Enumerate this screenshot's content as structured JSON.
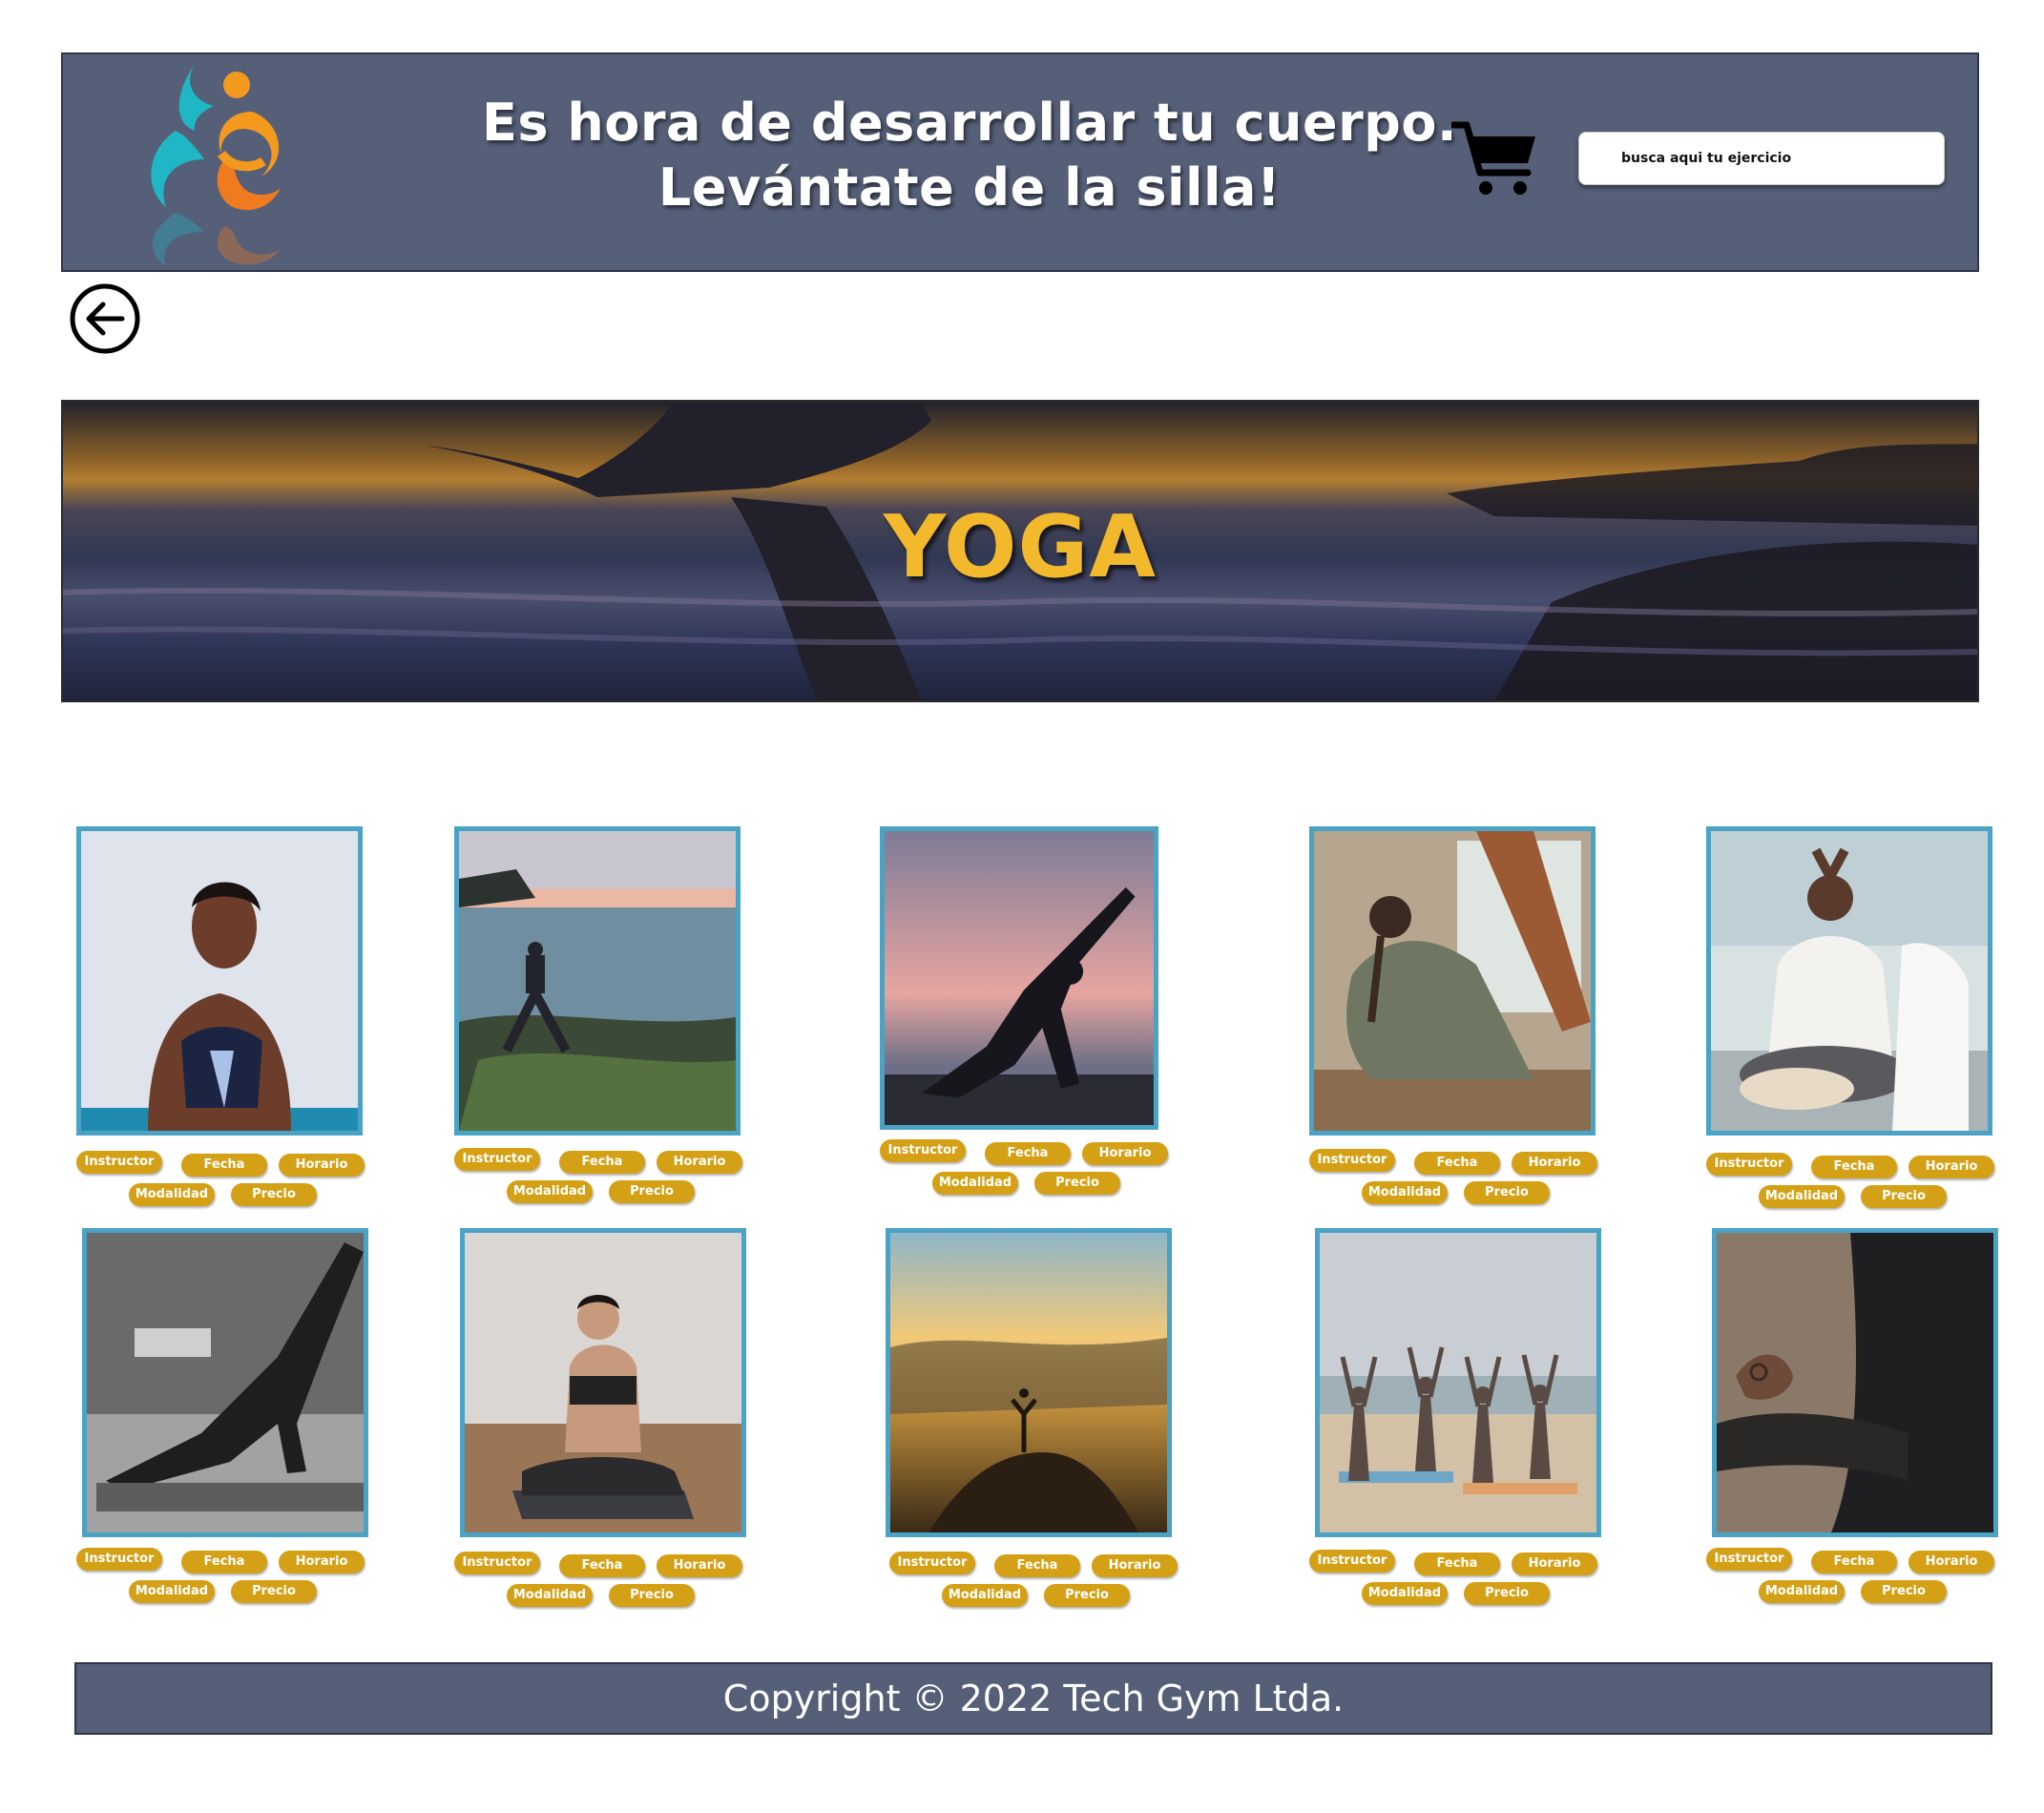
{
  "header": {
    "tagline_line1": "Es hora de desarrollar tu cuerpo.",
    "tagline_line2": "Levántate de la silla!",
    "logo_icon": "figure-logo-icon",
    "cart_icon": "shopping-cart-icon",
    "search_placeholder": "busca aqui tu ejercicio"
  },
  "nav": {
    "back_icon": "arrow-left-circle-icon"
  },
  "hero": {
    "title": "YOGA"
  },
  "cards": [
    {
      "image": "woman-praying-hands-yoga",
      "tags": {
        "instructor": "Instructor",
        "fecha": "Fecha",
        "horario": "Horario",
        "modalidad": "Modalidad",
        "precio": "Precio"
      }
    },
    {
      "image": "woman-yoga-on-rocks-by-sea",
      "tags": {
        "instructor": "Instructor",
        "fecha": "Fecha",
        "horario": "Horario",
        "modalidad": "Modalidad",
        "precio": "Precio"
      }
    },
    {
      "image": "silhouette-lunge-sunset",
      "tags": {
        "instructor": "Instructor",
        "fecha": "Fecha",
        "horario": "Horario",
        "modalidad": "Modalidad",
        "precio": "Precio"
      }
    },
    {
      "image": "woman-pigeon-pose-indoors",
      "tags": {
        "instructor": "Instructor",
        "fecha": "Fecha",
        "horario": "Horario",
        "modalidad": "Modalidad",
        "precio": "Precio"
      }
    },
    {
      "image": "woman-meditating-class",
      "tags": {
        "instructor": "Instructor",
        "fecha": "Fecha",
        "horario": "Horario",
        "modalidad": "Modalidad",
        "precio": "Precio"
      }
    },
    {
      "image": "downward-dog-black-and-white",
      "tags": {
        "instructor": "Instructor",
        "fecha": "Fecha",
        "horario": "Horario",
        "modalidad": "Modalidad",
        "precio": "Precio"
      }
    },
    {
      "image": "woman-seated-on-mat",
      "tags": {
        "instructor": "Instructor",
        "fecha": "Fecha",
        "horario": "Horario",
        "modalidad": "Modalidad",
        "precio": "Precio"
      }
    },
    {
      "image": "tree-pose-mountain-sunrise",
      "tags": {
        "instructor": "Instructor",
        "fecha": "Fecha",
        "horario": "Horario",
        "modalidad": "Modalidad",
        "precio": "Precio"
      }
    },
    {
      "image": "group-yoga-beach",
      "tags": {
        "instructor": "Instructor",
        "fecha": "Fecha",
        "horario": "Horario",
        "modalidad": "Modalidad",
        "precio": "Precio"
      }
    },
    {
      "image": "meditation-hands-closeup",
      "tags": {
        "instructor": "Instructor",
        "fecha": "Fecha",
        "horario": "Horario",
        "modalidad": "Modalidad",
        "precio": "Precio"
      }
    }
  ],
  "footer": {
    "copyright": "Copyright © 2022 Tech Gym Ltda."
  },
  "colors": {
    "header_bg": "#565f78",
    "tag_bg": "#d4a015",
    "card_border": "#4aa2c4",
    "hero_title": "#f2b92c"
  }
}
